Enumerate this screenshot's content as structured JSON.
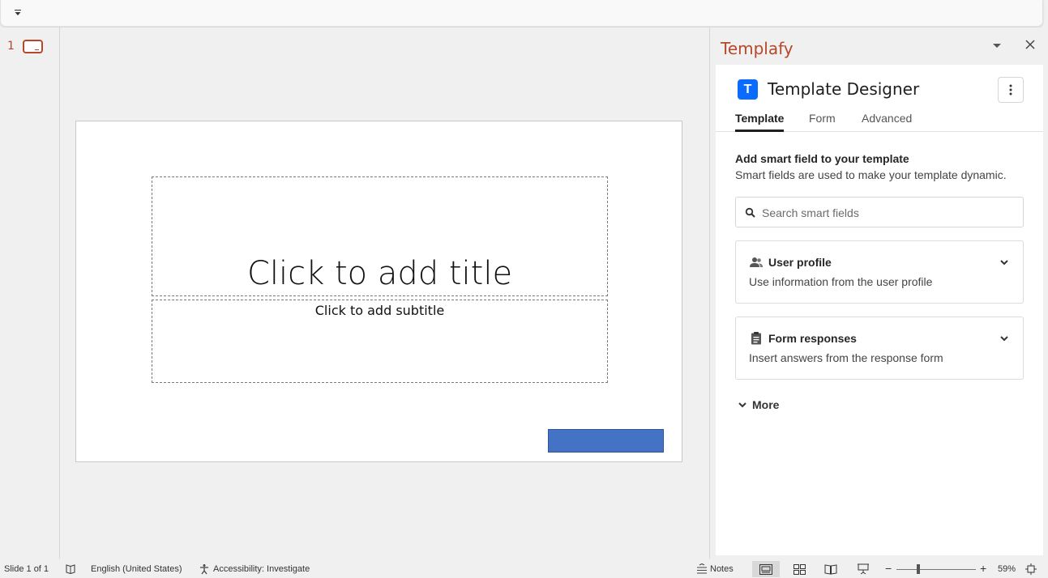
{
  "ribbon": {
    "qat_icon": "customize-quick-access-icon"
  },
  "thumbnails": {
    "slide_number": "1"
  },
  "slide": {
    "title_placeholder": "Click to add title",
    "subtitle_placeholder": "Click to add subtitle",
    "shape_color": "#4472c4"
  },
  "pane": {
    "title": "Templafy",
    "app_name": "Template Designer",
    "logo_letter": "T",
    "tabs": [
      {
        "label": "Template"
      },
      {
        "label": "Form"
      },
      {
        "label": "Advanced"
      }
    ],
    "section_title": "Add smart field to your template",
    "section_desc": "Smart fields are used to make your template dynamic.",
    "search_placeholder": "Search smart fields",
    "cards": [
      {
        "title": "User profile",
        "desc": "Use information from the user profile",
        "icon": "users-icon"
      },
      {
        "title": "Form responses",
        "desc": "Insert answers from the response form",
        "icon": "clipboard-icon"
      }
    ],
    "more_label": "More",
    "accent": "#b7472a",
    "brand": "#0a6cff"
  },
  "status": {
    "slide_info": "Slide 1 of 1",
    "language": "English (United States)",
    "accessibility": "Accessibility: Investigate",
    "notes": "Notes",
    "zoom": "59%"
  }
}
